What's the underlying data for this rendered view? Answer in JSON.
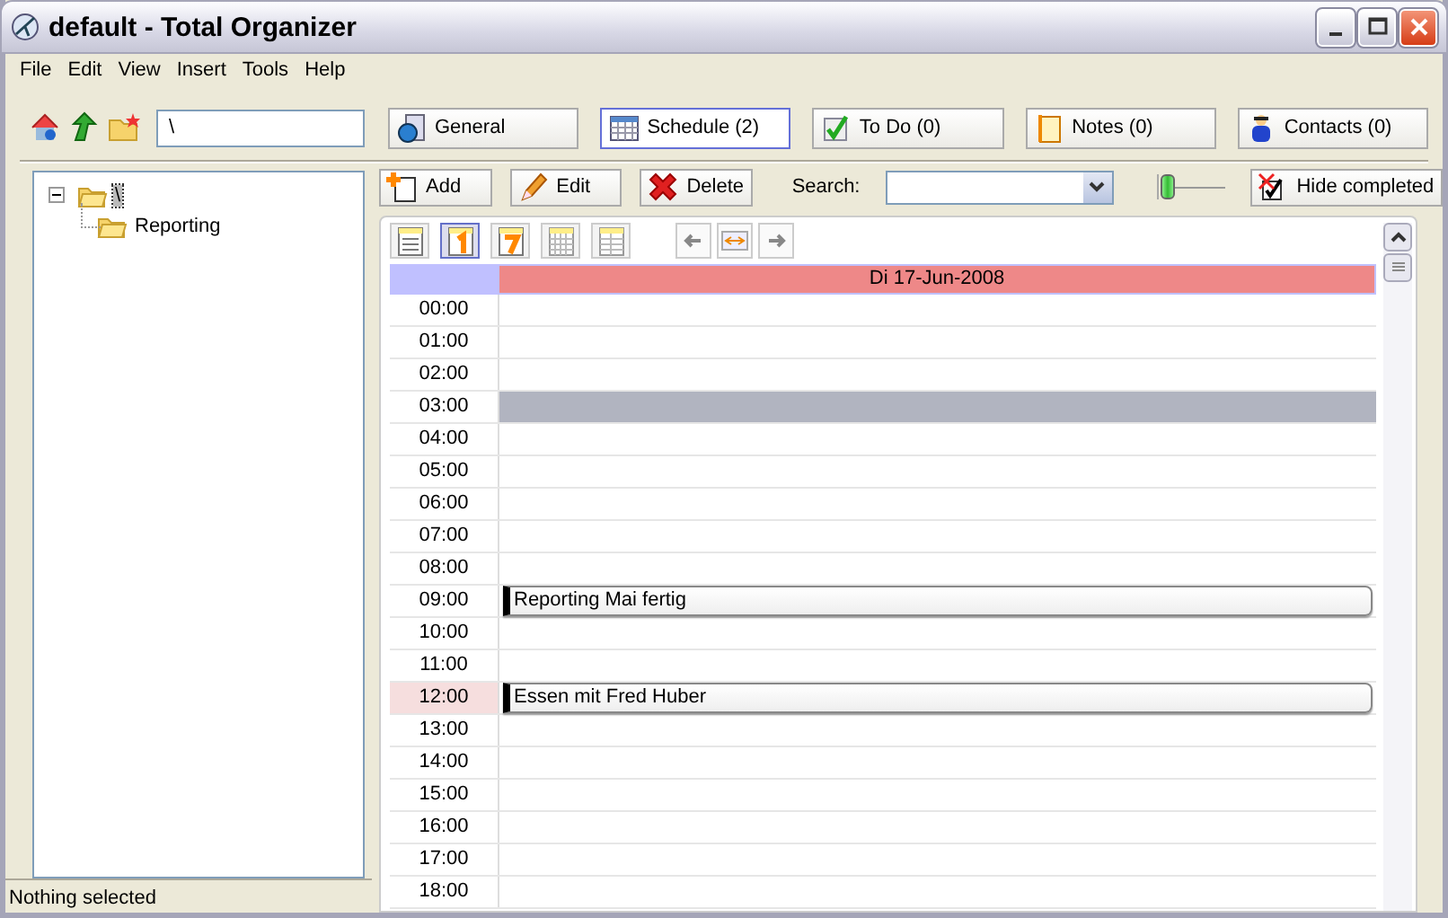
{
  "window": {
    "title": "default - Total Organizer"
  },
  "menu": [
    "File",
    "Edit",
    "View",
    "Insert",
    "Tools",
    "Help"
  ],
  "path_field": {
    "value": "\\"
  },
  "tabs": [
    {
      "label": "General",
      "kind": "general",
      "selected": false
    },
    {
      "label": "Schedule (2)",
      "kind": "schedule",
      "selected": true
    },
    {
      "label": "To Do (0)",
      "kind": "todo",
      "selected": false
    },
    {
      "label": "Notes (0)",
      "kind": "notes",
      "selected": false
    },
    {
      "label": "Contacts (0)",
      "kind": "contacts",
      "selected": false
    }
  ],
  "tree": [
    {
      "label": "\\",
      "selected": true,
      "expanded": true,
      "children": [
        {
          "label": "Reporting",
          "selected": false
        }
      ]
    }
  ],
  "actions": [
    {
      "label": "Add",
      "kind": "add"
    },
    {
      "label": "Edit",
      "kind": "edit"
    },
    {
      "label": "Delete",
      "kind": "delete"
    }
  ],
  "search": {
    "label": "Search:"
  },
  "zoom_slider": {
    "level": 0
  },
  "hide_completed": {
    "label": "Hide completed"
  },
  "views": [
    {
      "kind": "list",
      "selected": false
    },
    {
      "kind": "day",
      "selected": true
    },
    {
      "kind": "week",
      "selected": false
    },
    {
      "kind": "month",
      "selected": false
    },
    {
      "kind": "columns",
      "selected": false
    }
  ],
  "schedule": {
    "date": "Di 17-Jun-2008",
    "hours": [
      {
        "label": "00:00",
        "current": false,
        "selected": false
      },
      {
        "label": "01:00",
        "current": false,
        "selected": false
      },
      {
        "label": "02:00",
        "current": false,
        "selected": false
      },
      {
        "label": "03:00",
        "current": false,
        "selected": true
      },
      {
        "label": "04:00",
        "current": false,
        "selected": false
      },
      {
        "label": "05:00",
        "current": false,
        "selected": false
      },
      {
        "label": "06:00",
        "current": false,
        "selected": false
      },
      {
        "label": "07:00",
        "current": false,
        "selected": false
      },
      {
        "label": "08:00",
        "current": false,
        "selected": false
      },
      {
        "label": "09:00",
        "current": false,
        "selected": false,
        "event": "Reporting Mai fertig"
      },
      {
        "label": "10:00",
        "current": false,
        "selected": false
      },
      {
        "label": "11:00",
        "current": false,
        "selected": false
      },
      {
        "label": "12:00",
        "current": true,
        "selected": false,
        "event": "Essen mit Fred Huber"
      },
      {
        "label": "13:00",
        "current": false,
        "selected": false
      },
      {
        "label": "14:00",
        "current": false,
        "selected": false
      },
      {
        "label": "15:00",
        "current": false,
        "selected": false
      },
      {
        "label": "16:00",
        "current": false,
        "selected": false
      },
      {
        "label": "17:00",
        "current": false,
        "selected": false
      },
      {
        "label": "18:00",
        "current": false,
        "selected": false
      }
    ]
  },
  "status_bar": "Nothing selected"
}
